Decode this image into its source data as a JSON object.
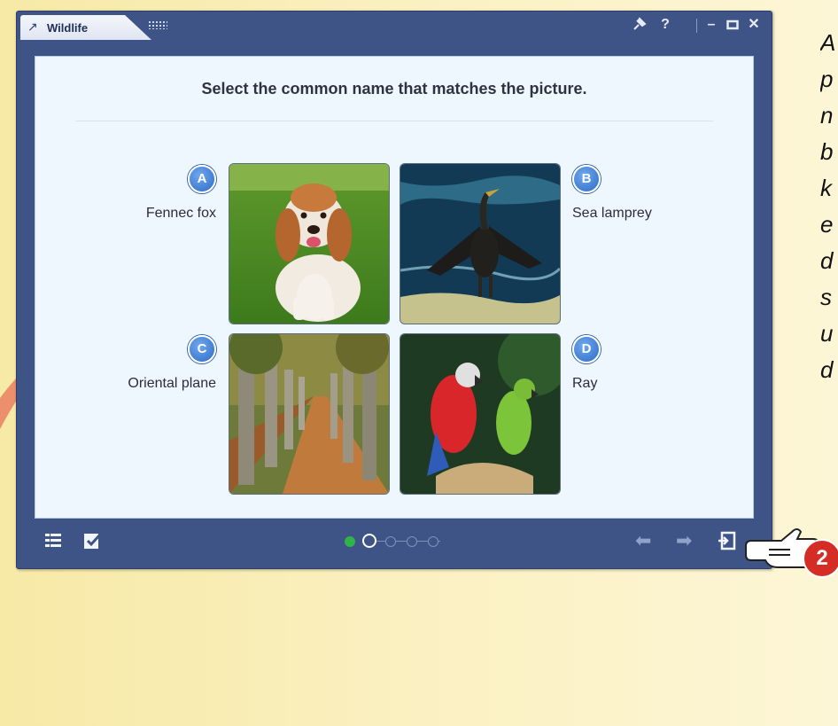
{
  "window": {
    "tab_title": "Wildlife",
    "icons": {
      "tab": "wand-icon",
      "pin": "pin-icon",
      "help": "help-icon",
      "minimize": "minimize-icon",
      "maximize": "maximize-icon",
      "close": "close-icon"
    }
  },
  "quiz": {
    "question": "Select the common name that matches the picture.",
    "options": [
      {
        "letter": "A",
        "label": "Fennec fox",
        "picture": "dog"
      },
      {
        "letter": "B",
        "label": "Sea lamprey",
        "picture": "cormorant"
      },
      {
        "letter": "C",
        "label": "Oriental plane",
        "picture": "tree-avenue"
      },
      {
        "letter": "D",
        "label": "Ray",
        "picture": "macaws"
      }
    ]
  },
  "footer": {
    "left_icons": [
      "list-icon",
      "checklist-icon"
    ],
    "pager": {
      "current": 2,
      "total": 5,
      "completed": 1
    },
    "right_icons": [
      "back-arrow-icon",
      "forward-arrow-icon",
      "submit-icon"
    ]
  },
  "callout": {
    "step": "2"
  },
  "side_text": [
    "A",
    "p",
    "n",
    "b",
    "k",
    "e",
    "d",
    "s",
    "u",
    "d"
  ],
  "colors": {
    "window": "#3e5386",
    "badge": "#2e6bc6",
    "step": "#d32d25",
    "pager_active": "#2fb34a"
  }
}
